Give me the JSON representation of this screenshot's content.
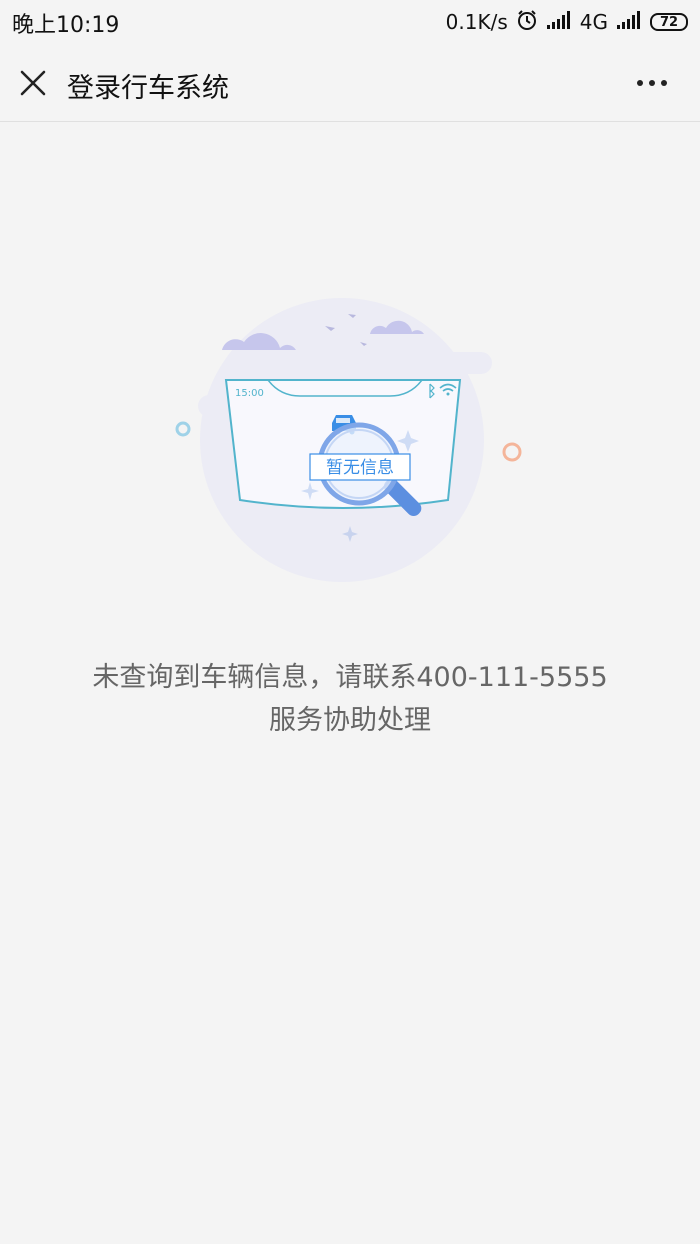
{
  "status_bar": {
    "time": "晚上10:19",
    "net_speed": "0.1K/s",
    "network_type": "4G",
    "battery_level": "72",
    "icons": [
      "alarm-icon",
      "signal-icon",
      "signal-icon",
      "battery-icon"
    ]
  },
  "header": {
    "title": "登录行车系统",
    "close_icon": "close-icon",
    "more_icon": "more-icon"
  },
  "illustration": {
    "screen_time": "15:00",
    "badge_text": "暂无信息",
    "icons": [
      "cloud-icon",
      "bird-icon",
      "bluetooth-icon",
      "wifi-icon",
      "car-icon",
      "magnifier-icon",
      "sparkle-icon"
    ]
  },
  "message": {
    "line1": "未查询到车辆信息，请联系400-111-5555",
    "line2": "服务协助处理"
  },
  "colors": {
    "background": "#f4f4f4",
    "accent_blue": "#3a8ee6",
    "circle_bg": "#ececf5",
    "orange_ring": "#f4b59a"
  }
}
